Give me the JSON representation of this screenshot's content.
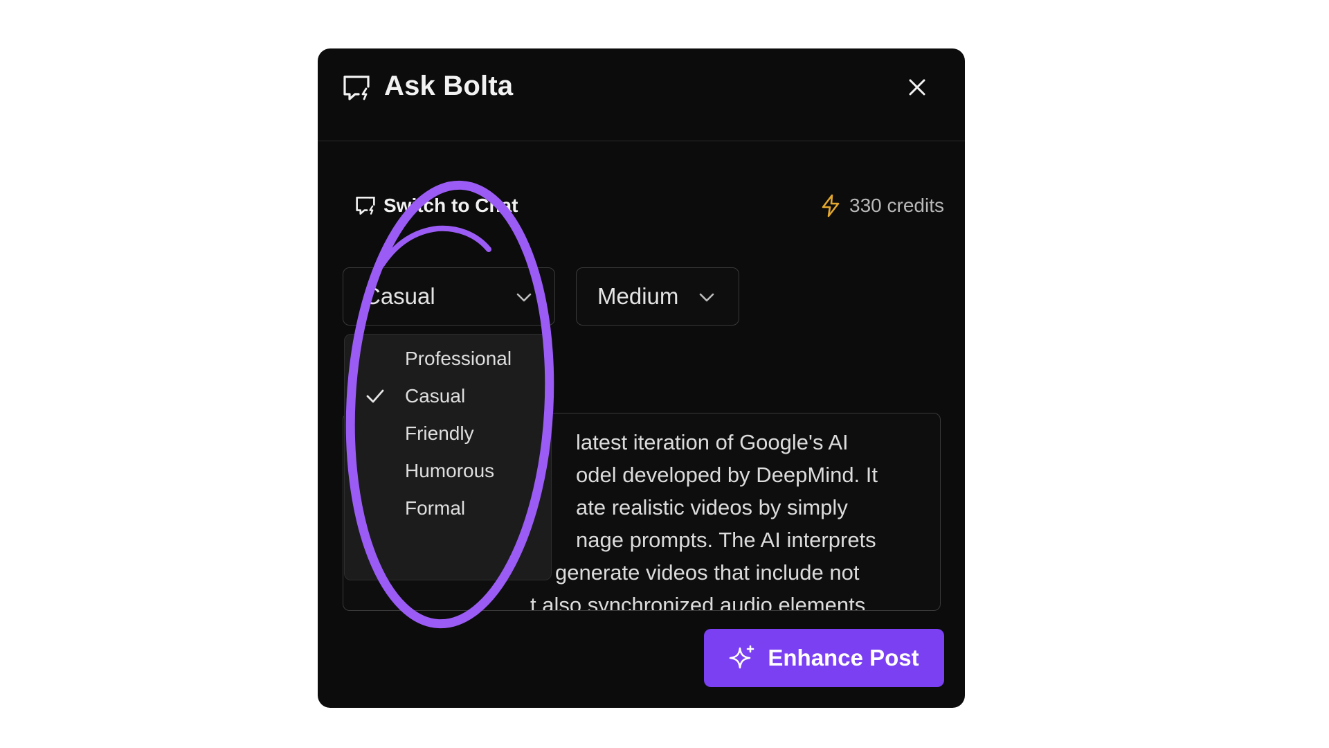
{
  "header": {
    "title": "Ask Bolta",
    "chat_icon": "chat-bubble-icon",
    "close_icon": "close-icon"
  },
  "toolbar": {
    "switch_label": "Switch to Chat",
    "credits_label": "330 credits",
    "credits_icon": "lightning-icon"
  },
  "tone_select": {
    "value": "Casual",
    "options": [
      "Professional",
      "Casual",
      "Friendly",
      "Humorous",
      "Formal"
    ],
    "selected": "Casual"
  },
  "length_select": {
    "value": "Medium"
  },
  "post_text": {
    "lines": [
      "latest iteration of Google's AI",
      "odel developed by DeepMind. It",
      "ate realistic videos by simply",
      "nage prompts. The AI interprets",
      "generate videos that include not",
      "t also synchronized audio elements"
    ]
  },
  "enhance_button": {
    "label": "Enhance Post",
    "icon": "sparkles-icon"
  },
  "colors": {
    "accent": "#7a40f2",
    "modal_bg": "#0c0c0c",
    "credits_icon": "#e3a72f",
    "annotation": "#9b5cf6"
  }
}
